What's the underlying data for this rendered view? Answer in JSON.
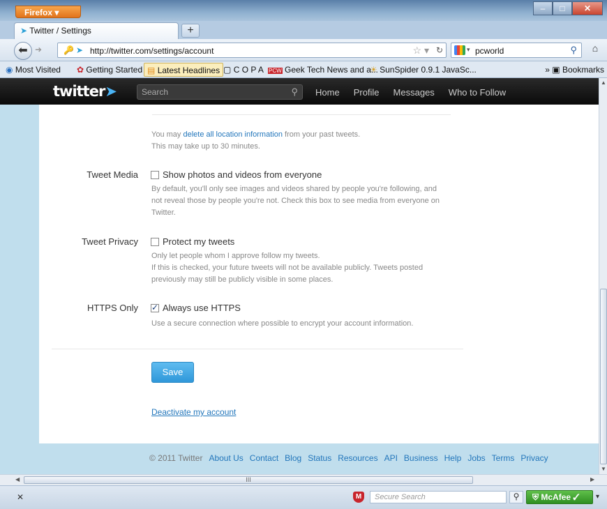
{
  "browser": {
    "app_button": "Firefox",
    "tab_title": "Twitter / Settings",
    "new_tab": "+",
    "url": "http://twitter.com/settings/account",
    "search_value": "pcworld",
    "bookmarks": [
      "Most Visited",
      "Getting Started",
      "Latest Headlines",
      "C O P A",
      "Geek Tech News and a...",
      "SunSpider 0.9.1 JavaSc..."
    ],
    "bookmarks_more": "Bookmarks"
  },
  "twitter": {
    "logo": "twitter",
    "search_placeholder": "Search",
    "nav": [
      "Home",
      "Profile",
      "Messages",
      "Who to Follow"
    ]
  },
  "settings": {
    "location": {
      "pre": "You may ",
      "link": "delete all location information",
      "post": " from your past tweets.",
      "line2": "This may take up to 30 minutes."
    },
    "tweet_media": {
      "label": "Tweet Media",
      "option": "Show photos and videos from everyone",
      "checked": false,
      "help": "By default, you'll only see images and videos shared by people you're following, and not reveal those by people you're not. Check this box to see media from everyone on Twitter."
    },
    "tweet_privacy": {
      "label": "Tweet Privacy",
      "option": "Protect my tweets",
      "checked": false,
      "help1": "Only let people whom I approve follow my tweets.",
      "help2": "If this is checked, your future tweets will not be available publicly. Tweets posted previously may still be publicly visible in some places."
    },
    "https": {
      "label": "HTTPS Only",
      "option": "Always use HTTPS",
      "checked": true,
      "help": "Use a secure connection where possible to encrypt your account information."
    },
    "save": "Save",
    "deactivate": "Deactivate my account"
  },
  "footer": {
    "copyright": "© 2011 Twitter",
    "links": [
      "About Us",
      "Contact",
      "Blog",
      "Status",
      "Resources",
      "API",
      "Business",
      "Help",
      "Jobs",
      "Terms",
      "Privacy"
    ]
  },
  "statusbar": {
    "secure_search_placeholder": "Secure Search",
    "mcafee": "McAfee"
  },
  "scroll": {
    "hthumb_grip": "III"
  }
}
